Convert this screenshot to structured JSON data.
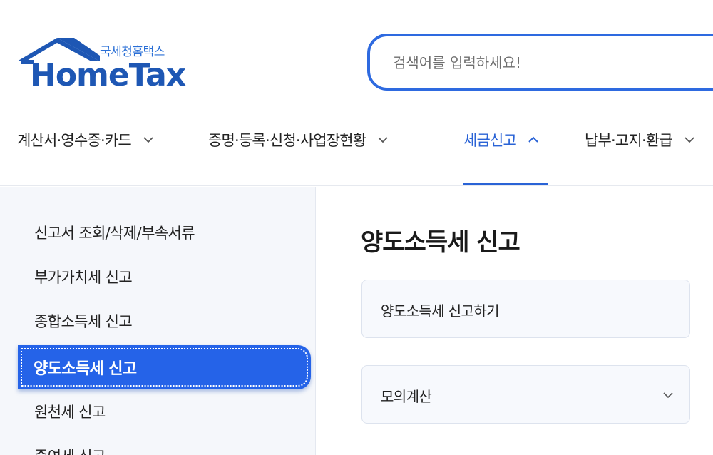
{
  "header": {
    "logo_sub": "국세청홈택스",
    "logo_main": "HomeTax",
    "search_placeholder": "검색어를 입력하세요!"
  },
  "nav": {
    "items": [
      {
        "label": "계산서·영수증·카드",
        "icon": "chevron-down-icon",
        "active": false
      },
      {
        "label": "증명·등록·신청·사업장현황",
        "icon": "chevron-down-icon",
        "active": false
      },
      {
        "label": "세금신고",
        "icon": "chevron-up-icon",
        "active": true
      },
      {
        "label": "납부·고지·환급",
        "icon": "chevron-down-icon",
        "active": false
      }
    ],
    "accent_color": "#2a63d6"
  },
  "sidebar": {
    "items": [
      {
        "label": "신고서 조회/삭제/부속서류"
      },
      {
        "label": "부가가치세 신고"
      },
      {
        "label": "종합소득세 신고"
      },
      {
        "label": "양도소득세 신고",
        "active": true
      },
      {
        "label": "원천세 신고"
      },
      {
        "label": "증여세 신고"
      }
    ],
    "active_color": "#2563e8"
  },
  "main": {
    "title": "양도소득세 신고",
    "cards": [
      {
        "label": "양도소득세 신고하기"
      },
      {
        "label": "모의계산",
        "icon": "chevron-down-icon"
      }
    ]
  }
}
